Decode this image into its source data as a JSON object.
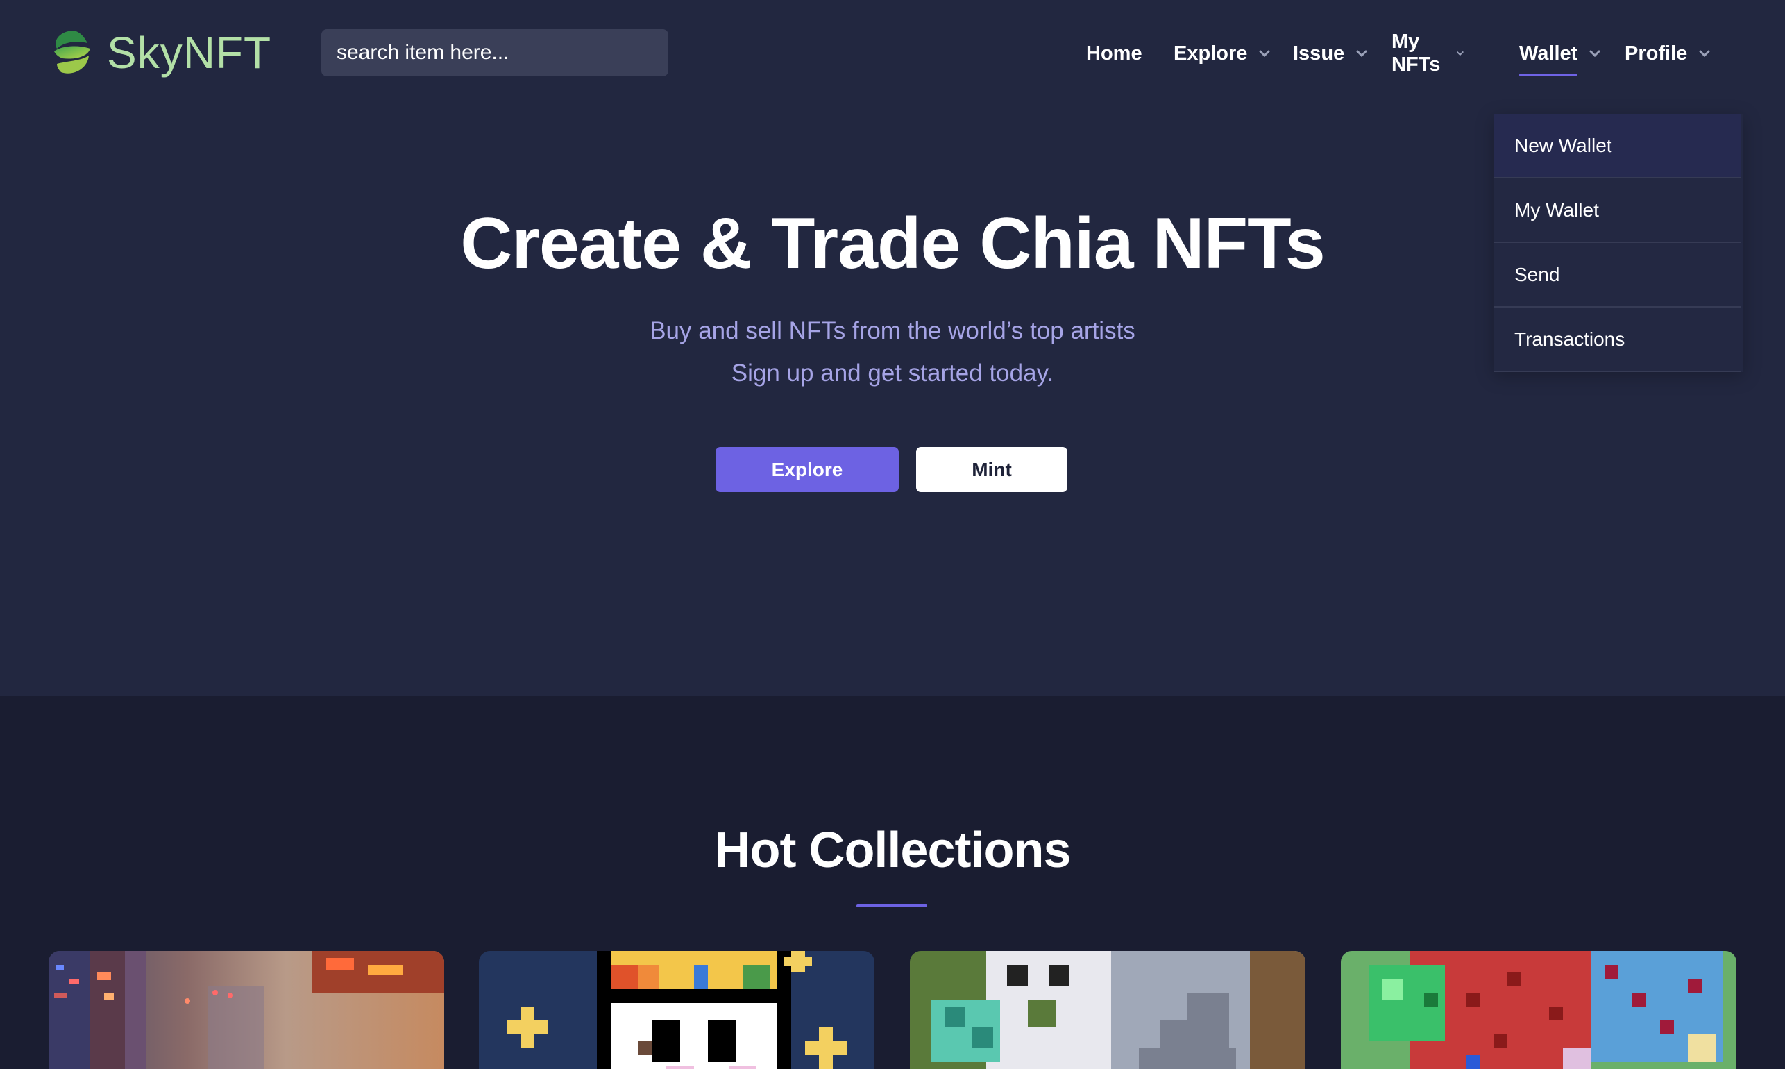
{
  "brand": {
    "name": "SkyNFT",
    "logo_icon": "leaf-swirl-logo",
    "text_color": "#b3e0a7"
  },
  "search": {
    "placeholder": "search item here..."
  },
  "nav": {
    "items": [
      {
        "label": "Home",
        "has_dropdown": false
      },
      {
        "label": "Explore",
        "has_dropdown": true
      },
      {
        "label": "Issue",
        "has_dropdown": true
      },
      {
        "label": "My NFTs",
        "has_dropdown": true
      },
      {
        "label": "Wallet",
        "has_dropdown": true,
        "active": true
      },
      {
        "label": "Profile",
        "has_dropdown": true
      }
    ]
  },
  "wallet_menu": {
    "items": [
      "New Wallet",
      "My Wallet",
      "Send",
      "Transactions"
    ]
  },
  "hero": {
    "title": "Create & Trade Chia NFTs",
    "subtitle_line1": "Buy and sell NFTs from the world’s top artists",
    "subtitle_line2": "Sign up and get started today.",
    "explore_label": "Explore",
    "mint_label": "Mint"
  },
  "hot_collections": {
    "title": "Hot Collections",
    "cards": [
      {
        "name": "collection-card-city"
      },
      {
        "name": "collection-card-pixel-cat"
      },
      {
        "name": "collection-card-pixel-creature"
      },
      {
        "name": "collection-card-pixel-garden"
      }
    ]
  },
  "colors": {
    "background": "#222740",
    "section_background": "#1a1d31",
    "accent": "#6d62e3",
    "subtitle": "#a6a4e6"
  }
}
